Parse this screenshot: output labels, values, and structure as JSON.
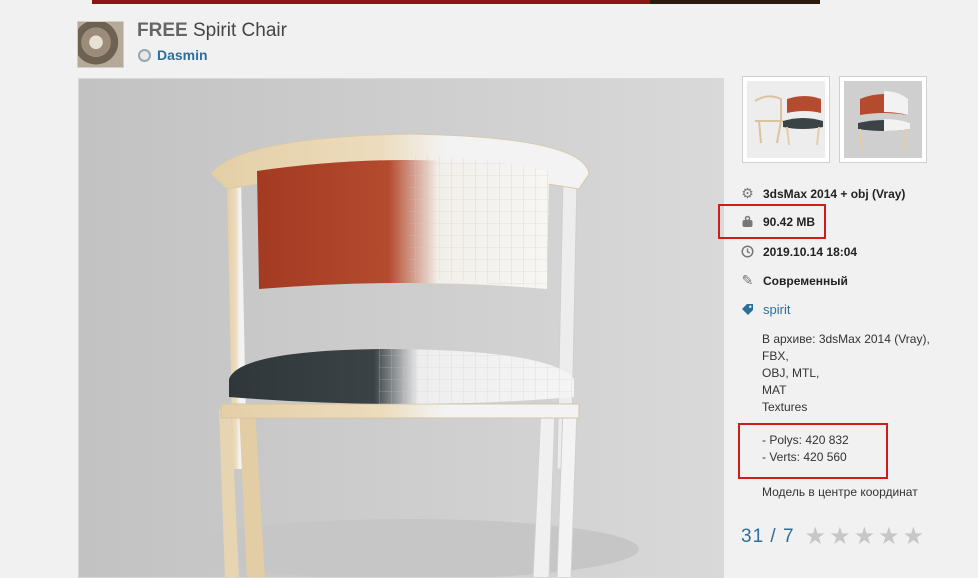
{
  "header": {
    "title_prefix": "FREE",
    "title": "Spirit Chair",
    "author": "Dasmin"
  },
  "info": {
    "software": "3dsMax 2014 + obj (Vray)",
    "size": "90.42 MB",
    "date": "2019.10.14 18:04",
    "style": "Современный",
    "tag": "spirit",
    "archive_lines": [
      "В архиве: 3dsMax 2014 (Vray),",
      "FBX,",
      "OBJ, MTL,",
      "MAT",
      "Textures"
    ],
    "polys": "- Polys: 420 832",
    "verts": "- Verts: 420 560",
    "center_note": "Модель в центре координат"
  },
  "rating": {
    "score": "31 / 7",
    "stars_total": 5,
    "stars_filled": 0
  },
  "icons": {
    "software": "gear-icon",
    "size": "weight-icon",
    "date": "clock-icon",
    "style": "pencil-icon",
    "tag": "tag-icon"
  },
  "colors": {
    "link": "#2d6f9c",
    "highlight": "#d11c1c",
    "seat": "#3b4347",
    "back_red": "#b0452c"
  }
}
